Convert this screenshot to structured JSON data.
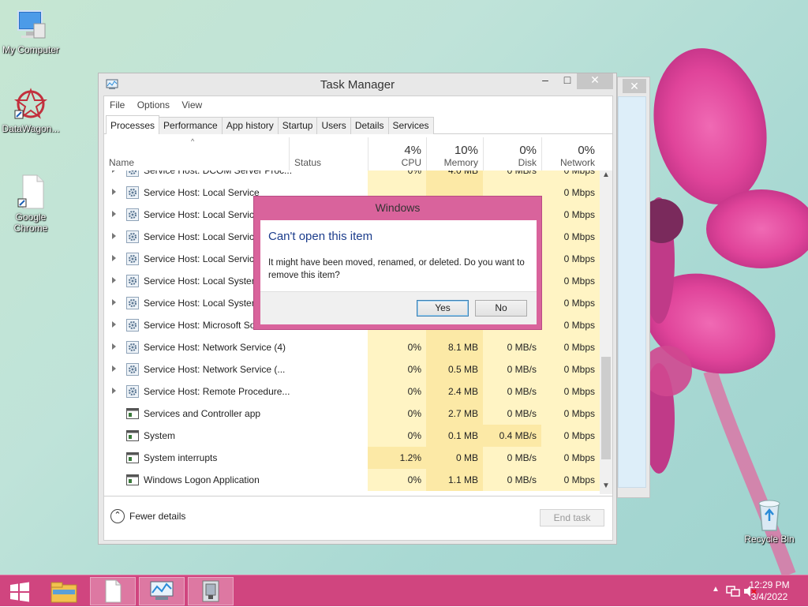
{
  "desktop": {
    "icons": [
      {
        "label": "My Computer",
        "icon": "computer-icon"
      },
      {
        "label": "DataWagon...",
        "icon": "datawagon-app-icon"
      },
      {
        "label": "Google\nChrome",
        "icon": "blank-file-shortcut-icon"
      },
      {
        "label": "Recycle Bin",
        "icon": "recycle-bin-icon"
      }
    ]
  },
  "task_manager": {
    "title": "Task Manager",
    "close_glyph": "✕",
    "minimize_glyph": "–",
    "maximize_glyph": "□",
    "menu": [
      "File",
      "Options",
      "View"
    ],
    "tabs": [
      "Processes",
      "Performance",
      "App history",
      "Startup",
      "Users",
      "Details",
      "Services"
    ],
    "active_tab": "Processes",
    "columns": {
      "name": "Name",
      "status": "Status",
      "cpu": {
        "pct": "4%",
        "label": "CPU"
      },
      "memory": {
        "pct": "10%",
        "label": "Memory"
      },
      "disk": {
        "pct": "0%",
        "label": "Disk"
      },
      "network": {
        "pct": "0%",
        "label": "Network"
      }
    },
    "rows": [
      {
        "name": "Service Host: DCOM Server Proc...",
        "cpu": "0%",
        "mem": "4.0 MB",
        "disk": "0 MB/s",
        "net": "0 Mbps",
        "expandable": true,
        "icon": "gear"
      },
      {
        "name": "Service Host: Local Service",
        "cpu": "",
        "mem": "",
        "disk": "",
        "net": "0 Mbps",
        "expandable": true,
        "icon": "gear"
      },
      {
        "name": "Service Host: Local Service",
        "cpu": "",
        "mem": "",
        "disk": "",
        "net": "0 Mbps",
        "expandable": true,
        "icon": "gear"
      },
      {
        "name": "Service Host: Local Service",
        "cpu": "",
        "mem": "",
        "disk": "",
        "net": "0 Mbps",
        "expandable": true,
        "icon": "gear"
      },
      {
        "name": "Service Host: Local Service",
        "cpu": "",
        "mem": "",
        "disk": "",
        "net": "0 Mbps",
        "expandable": true,
        "icon": "gear"
      },
      {
        "name": "Service Host: Local System",
        "cpu": "",
        "mem": "",
        "disk": "",
        "net": "0 Mbps",
        "expandable": true,
        "icon": "gear"
      },
      {
        "name": "Service Host: Local System",
        "cpu": "",
        "mem": "",
        "disk": "",
        "net": "0 Mbps",
        "expandable": true,
        "icon": "gear"
      },
      {
        "name": "Service Host: Microsoft Softwar...",
        "cpu": "0%",
        "mem": "0.7 MB",
        "disk": "0 MB/s",
        "net": "0 Mbps",
        "expandable": true,
        "icon": "gear"
      },
      {
        "name": "Service Host: Network Service (4)",
        "cpu": "0%",
        "mem": "8.1 MB",
        "disk": "0 MB/s",
        "net": "0 Mbps",
        "expandable": true,
        "icon": "gear"
      },
      {
        "name": "Service Host: Network Service (...",
        "cpu": "0%",
        "mem": "0.5 MB",
        "disk": "0 MB/s",
        "net": "0 Mbps",
        "expandable": true,
        "icon": "gear"
      },
      {
        "name": "Service Host: Remote Procedure...",
        "cpu": "0%",
        "mem": "2.4 MB",
        "disk": "0 MB/s",
        "net": "0 Mbps",
        "expandable": true,
        "icon": "gear"
      },
      {
        "name": "Services and Controller app",
        "cpu": "0%",
        "mem": "2.7 MB",
        "disk": "0 MB/s",
        "net": "0 Mbps",
        "expandable": false,
        "icon": "window"
      },
      {
        "name": "System",
        "cpu": "0%",
        "mem": "0.1 MB",
        "disk": "0.4 MB/s",
        "net": "0 Mbps",
        "expandable": false,
        "icon": "window"
      },
      {
        "name": "System interrupts",
        "cpu": "1.2%",
        "mem": "0 MB",
        "disk": "0 MB/s",
        "net": "0 Mbps",
        "expandable": false,
        "icon": "window"
      },
      {
        "name": "Windows Logon Application",
        "cpu": "0%",
        "mem": "1.1 MB",
        "disk": "0 MB/s",
        "net": "0 Mbps",
        "expandable": false,
        "icon": "window"
      }
    ],
    "fewer_details": "Fewer details",
    "end_task": "End task"
  },
  "background_window": {
    "close_glyph": "✕"
  },
  "dialog": {
    "title": "Windows",
    "heading": "Can't open this item",
    "message": "It might have been moved, renamed, or deleted. Do you want to remove this item?",
    "yes": "Yes",
    "no": "No"
  },
  "taskbar": {
    "time": "12:29 PM",
    "date": "3/4/2022",
    "buttons": [
      "start-icon",
      "file-explorer-icon",
      "blank-document-icon",
      "task-manager-icon",
      "archive-app-icon"
    ]
  },
  "colors": {
    "taskbar": "#d0457f",
    "dialog_frame": "#d9639c",
    "dialog_heading": "#1c3d8c",
    "heat_light": "#fff4c4",
    "heat_dark": "#fce9a6"
  }
}
